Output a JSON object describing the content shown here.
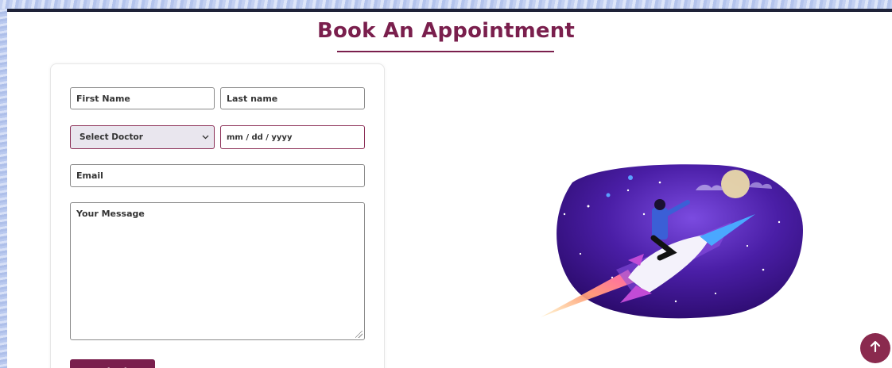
{
  "page": {
    "title": "Book An Appointment"
  },
  "form": {
    "first_name": {
      "placeholder": "First Name"
    },
    "last_name": {
      "placeholder": "Last name"
    },
    "doctor_select": {
      "selected": "Select Doctor"
    },
    "date": {
      "placeholder": "mm / dd / yyyy"
    },
    "email": {
      "placeholder": "Email"
    },
    "message": {
      "placeholder": "Your Message"
    },
    "submit_label": "Submit"
  },
  "icons": {
    "select_chevron": "chevron-down-icon",
    "scroll_top": "arrow-up-icon"
  },
  "colors": {
    "accent": "#7a1f4d",
    "scroll_button": "#8a2a4e",
    "select_bg": "#e9e6ee"
  }
}
